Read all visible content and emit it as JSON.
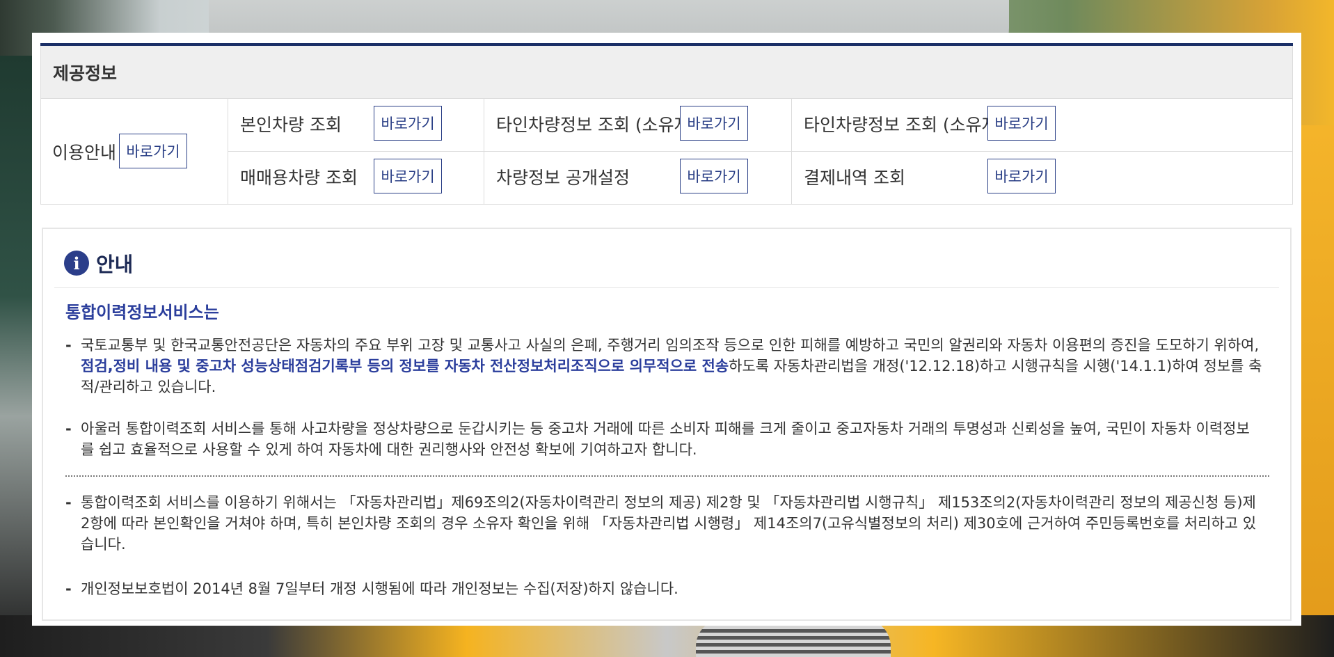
{
  "provide": {
    "title": "제공정보",
    "guide_label": "이용안내",
    "go_label": "바로가기",
    "items": [
      {
        "label": "본인차량 조회"
      },
      {
        "label": "타인차량정보 조회 (소유자동의)"
      },
      {
        "label": "타인차량정보 조회 (소유자미동의)"
      },
      {
        "label": "매매용차량 조회"
      },
      {
        "label": "차량정보 공개설정"
      },
      {
        "label": "결제내역 조회"
      }
    ]
  },
  "notice": {
    "icon": "info-icon",
    "icon_glyph": "i",
    "title": "안내",
    "subtitle": "통합이력정보서비스는",
    "p1_before": "국토교통부 및 한국교통안전공단은 자동차의 주요 부위 고장 및 교통사고 사실의 은폐, 주행거리 임의조작 등으로 인한 피해를 예방하고 국민의 알권리와 자동차 이용편의 증진을 도모하기 위하여, ",
    "p1_highlight": "점검,정비 내용 및 중고차 성능상태점검기록부 등의 정보를 자동차 전산정보처리조직으로 의무적으로 전송",
    "p1_after": "하도록 자동차관리법을 개정('12.12.18)하고 시행규칙을 시행('14.1.1)하여 정보를 축적/관리하고 있습니다.",
    "p2": "아울러 통합이력조회 서비스를 통해 사고차량을 정상차량으로 둔갑시키는 등 중고차 거래에 따른 소비자 피해를 크게 줄이고 중고자동차 거래의 투명성과 신뢰성을 높여, 국민이 자동차 이력정보를 쉽고 효율적으로 사용할 수 있게 하여 자동차에 대한 권리행사와 안전성 확보에 기여하고자 합니다.",
    "p3": "통합이력조회 서비스를 이용하기 위해서는 「자동차관리법」제69조의2(자동차이력관리 정보의 제공) 제2항 및 「자동차관리법 시행규칙」 제153조의2(자동차이력관리 정보의 제공신청 등)제2항에 따라 본인확인을 거쳐야 하며, 특히 본인차량 조회의 경우 소유자 확인을 위해 「자동차관리법 시행령」 제14조의7(고유식별정보의 처리) 제30호에 근거하여 주민등록번호를 처리하고 있습니다.",
    "p4": "개인정보보호법이 2014년 8월 7일부터 개정 시행됨에 따라 개인정보는 수집(저장)하지 않습니다.",
    "bullet": "-"
  },
  "colors": {
    "accent": "#2b3e9c",
    "header_bar": "#1a2f66"
  }
}
